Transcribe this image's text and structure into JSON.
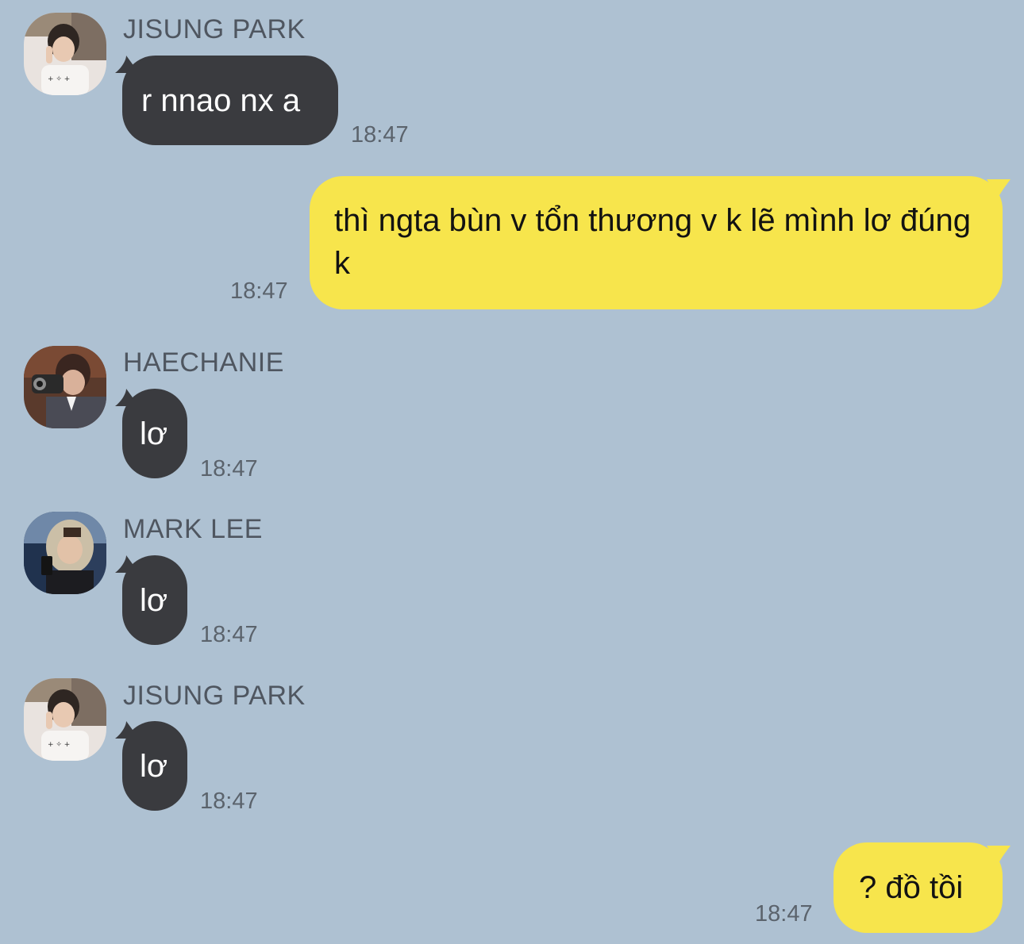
{
  "colors": {
    "background": "#aec1d2",
    "incoming_bubble": "#3a3b3f",
    "outgoing_bubble": "#f7e54c",
    "name_text": "#4f5660",
    "time_text": "#5b636c"
  },
  "messages": [
    {
      "sender": "JISUNG PARK",
      "text": "r nnao nx a",
      "time": "18:47",
      "direction": "incoming",
      "avatar": "avatar-jisung"
    },
    {
      "sender": "",
      "text": "thì ngta bùn v tổn thương v k lẽ mình lơ đúng k",
      "time": "18:47",
      "direction": "outgoing"
    },
    {
      "sender": "HAECHANIE",
      "text": "lơ",
      "time": "18:47",
      "direction": "incoming",
      "avatar": "avatar-haechan"
    },
    {
      "sender": "MARK LEE",
      "text": "lơ",
      "time": "18:47",
      "direction": "incoming",
      "avatar": "avatar-mark"
    },
    {
      "sender": "JISUNG PARK",
      "text": "lơ",
      "time": "18:47",
      "direction": "incoming",
      "avatar": "avatar-jisung"
    },
    {
      "sender": "",
      "text": "? đồ tồi",
      "time": "18:47",
      "direction": "outgoing"
    }
  ]
}
